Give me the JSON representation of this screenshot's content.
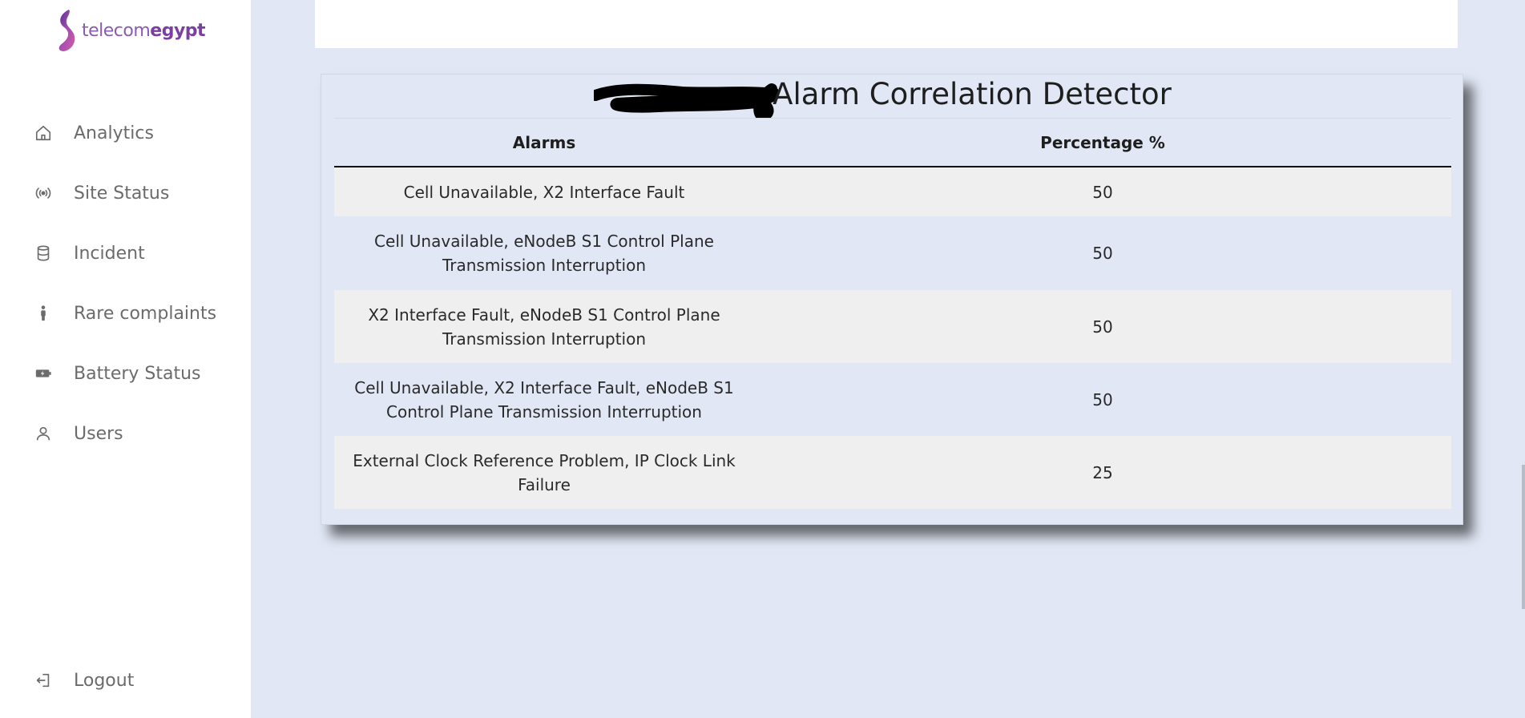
{
  "brand": {
    "prefix": "telecom",
    "suffix": "egypt"
  },
  "sidebar": {
    "items": [
      {
        "label": "Analytics",
        "icon": "home-icon"
      },
      {
        "label": "Site Status",
        "icon": "broadcast-icon"
      },
      {
        "label": "Incident",
        "icon": "database-icon"
      },
      {
        "label": "Rare complaints",
        "icon": "person-icon"
      },
      {
        "label": "Battery Status",
        "icon": "battery-icon"
      },
      {
        "label": "Users",
        "icon": "user-icon"
      }
    ],
    "logout": {
      "label": "Logout",
      "icon": "logout-icon"
    }
  },
  "panel": {
    "title": "Alarm Correlation Detector",
    "columns": [
      "Alarms",
      "Percentage %"
    ],
    "rows": [
      {
        "alarms": "Cell Unavailable, X2 Interface Fault",
        "percentage": "50"
      },
      {
        "alarms": "Cell Unavailable, eNodeB S1 Control Plane Transmission Interruption",
        "percentage": "50"
      },
      {
        "alarms": "X2 Interface Fault, eNodeB S1 Control Plane Transmission Interruption",
        "percentage": "50"
      },
      {
        "alarms": "Cell Unavailable, X2 Interface Fault, eNodeB S1 Control Plane Transmission Interruption",
        "percentage": "50"
      },
      {
        "alarms": "External Clock Reference Problem, IP Clock Link Failure",
        "percentage": "25"
      }
    ]
  },
  "colors": {
    "background": "#e1e7f5",
    "sidebar": "#ffffff",
    "brand": "#7a3fa0",
    "row_alt": "#efefef"
  }
}
